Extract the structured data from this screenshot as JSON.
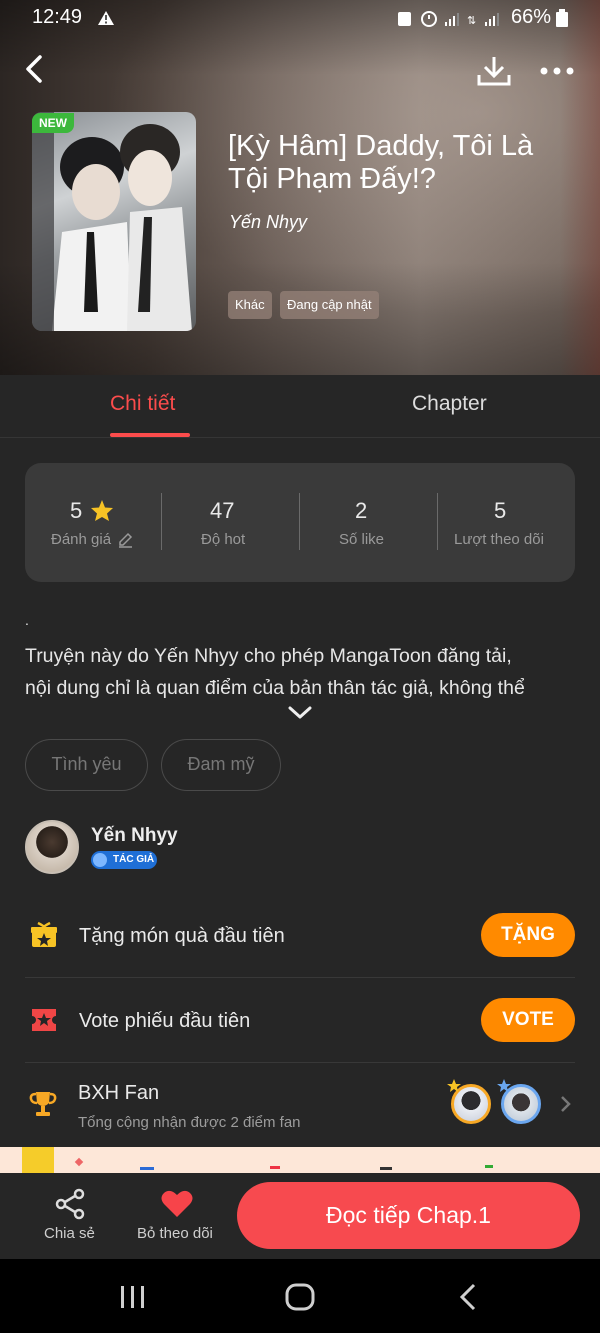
{
  "status_bar": {
    "time": "12:49",
    "battery": "66%"
  },
  "header": {
    "badge": "NEW",
    "title": "[Kỳ Hâm] Daddy, Tôi Là Tội Phạm Đấy!?",
    "author": "Yến Nhyy",
    "tags": [
      "Khác",
      "Đang cập nhật"
    ]
  },
  "tabs": [
    {
      "label": "Chi tiết",
      "active": true
    },
    {
      "label": "Chapter",
      "active": false
    }
  ],
  "stats": [
    {
      "value": "5",
      "label": "Đánh giá"
    },
    {
      "value": "47",
      "label": "Độ hot"
    },
    {
      "value": "2",
      "label": "Số like"
    },
    {
      "value": "5",
      "label": "Lượt theo dõi"
    }
  ],
  "description": {
    "dot": ".",
    "line1": "Truyện này do Yến Nhyy cho phép MangaToon đăng tải,",
    "line2": "nội dung chỉ là quan điểm của bản thân tác giả, không thể"
  },
  "genres": [
    "Tình yêu",
    "Đam mỹ"
  ],
  "author_section": {
    "name": "Yến Nhyy",
    "badge": "TÁC GIẢ"
  },
  "gift_row": {
    "label": "Tặng món quà đầu tiên",
    "button": "TẶNG"
  },
  "vote_row": {
    "label": "Vote phiếu đầu tiên",
    "button": "VOTE"
  },
  "fan_rank": {
    "title": "BXH Fan",
    "subtitle": "Tổng cộng nhận được 2 điểm fan"
  },
  "bottom_bar": {
    "share": "Chia sẻ",
    "unfollow": "Bỏ theo dõi",
    "read": "Đọc tiếp Chap.1"
  },
  "colors": {
    "accent": "#f74a4f",
    "orange": "#ff8a00",
    "background": "#262626",
    "new_badge": "#3cb83c"
  }
}
